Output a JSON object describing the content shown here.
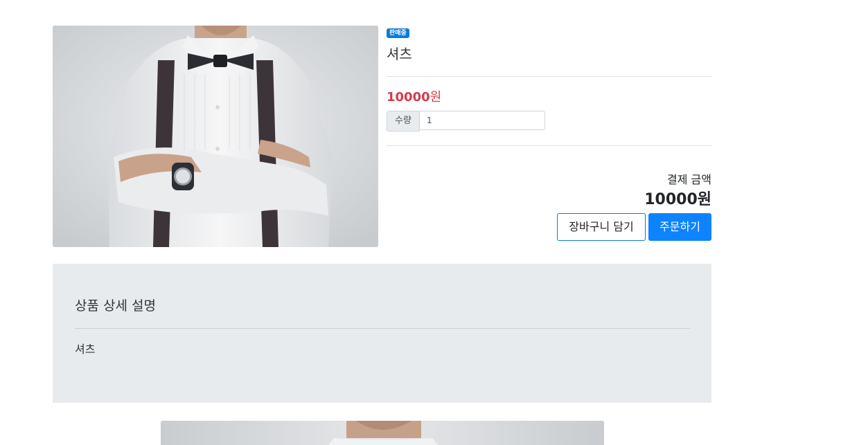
{
  "product": {
    "badge": "판매중",
    "name": "셔츠",
    "price_value": "10000",
    "price_unit": "원",
    "quantity_label": "수량",
    "quantity_value": "1",
    "payment_label": "결제 금액",
    "payment_total": "10000원",
    "cart_button": "장바구니 담기",
    "order_button": "주문하기"
  },
  "detail": {
    "title": "상품 상세 설명",
    "body": "셔츠"
  },
  "colors": {
    "badge": "#0a7bd9",
    "price": "#d83a4a",
    "primary": "#0d84ff",
    "detail_bg": "#e8ebee"
  }
}
